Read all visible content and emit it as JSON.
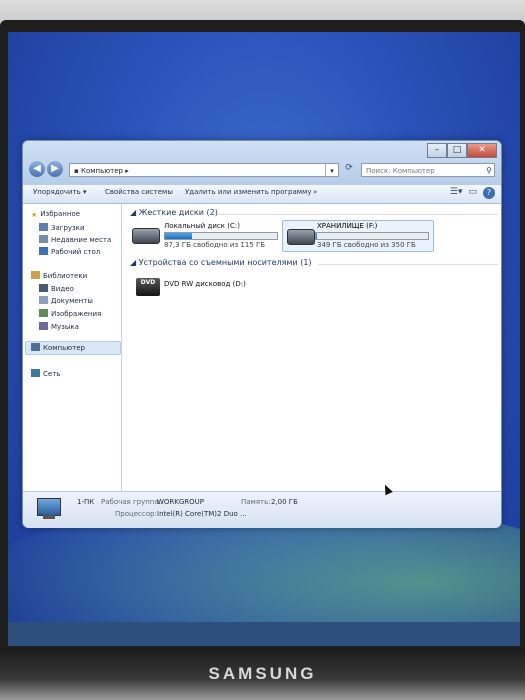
{
  "monitor": {
    "brand": "SAMSUNG"
  },
  "window": {
    "address": "Компьютер",
    "search_placeholder": "Поиск: Компьютер",
    "toolbar": {
      "organize": "Упорядочить ▾",
      "system_properties": "Свойства системы",
      "uninstall": "Удалить или изменить программу",
      "more": "»"
    },
    "nav": {
      "favorites": "Избранное",
      "downloads": "Загрузки",
      "recent": "Недавние места",
      "desktop": "Рабочий стол",
      "libraries": "Библиотеки",
      "video": "Видео",
      "documents": "Документы",
      "images": "Изображения",
      "music": "Музыка",
      "computer": "Компьютер",
      "network": "Сеть"
    },
    "content": {
      "hard_disks_header": "Жесткие диски (2)",
      "drives": [
        {
          "name": "Локальный диск (C:)",
          "info": "87,3 ГБ свободно из 115 ГБ",
          "used_fraction": 0.24
        },
        {
          "name": "ХРАНИЛИЩЕ (F:)",
          "info": "349 ГБ свободно из 350 ГБ",
          "used_fraction": 0.003
        }
      ],
      "removable_header": "Устройства со съемными носителями (1)",
      "dvd": {
        "name": "DVD RW дисковод (D:)",
        "icon_text": "DVD"
      }
    },
    "details": {
      "computer_name": "1-ПК",
      "workgroup_label": "Рабочая группа:",
      "workgroup_value": "WORKGROUP",
      "memory_label": "Память:",
      "memory_value": "2,00 ГБ",
      "cpu_label": "Процессор:",
      "cpu_value": "Intel(R) Core(TM)2 Duo ..."
    }
  }
}
